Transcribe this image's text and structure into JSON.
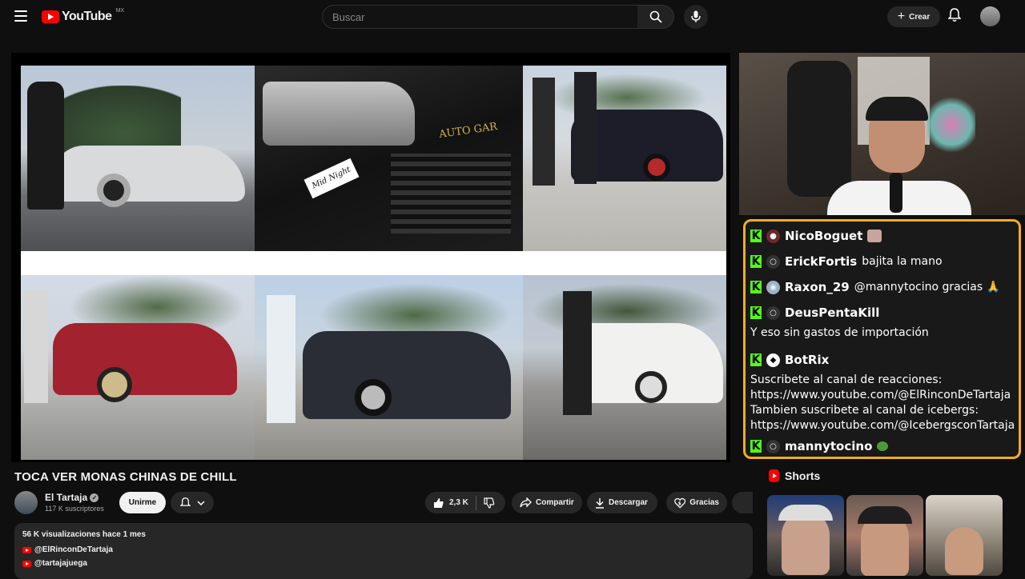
{
  "header": {
    "logo_text": "YouTube",
    "country_code": "MX",
    "search_placeholder": "Buscar",
    "create_label": "Crear"
  },
  "chat": {
    "messages": [
      {
        "user": "NicoBoguet",
        "text": "",
        "emote": "emote-face"
      },
      {
        "user": "ErickFortis",
        "text": "bajita la mano"
      },
      {
        "user": "Raxon_29",
        "text": "@mannytocino gracias 🙏"
      },
      {
        "user": "DeusPentaKill",
        "text": "Y eso sin gastos de importación"
      },
      {
        "user": "BotRix",
        "text": "Suscribete al canal de reacciones: https://www.youtube.com/@ElRinconDeTartaja Tambien suscribete al canal de icebergs: https://www.youtube.com/@IcebergsconTartaja"
      },
      {
        "user": "mannytocino",
        "text": "",
        "emote": "emote-frog"
      }
    ],
    "botrix_lines": [
      "Suscribete al canal de reacciones:",
      "https://www.youtube.com/@ElRinconDeTartaja",
      "Tambien suscribete al canal de icebergs:",
      "https://www.youtube.com/@IcebergsconTartaja"
    ],
    "badge_letter": "K",
    "accent_color": "#f2ad1f",
    "badge_color": "#53fc18"
  },
  "video": {
    "title": "TOCA VER MONAS CHINAS DE CHILL",
    "photo_text_1": "AUTO GAR",
    "photo_text_2": "Mid Night"
  },
  "channel": {
    "name": "El Tartaja",
    "subscribers": "117 K suscriptores",
    "join_label": "Unirme"
  },
  "actions": {
    "likes": "2,3 K",
    "share": "Compartir",
    "download": "Descargar",
    "thanks": "Gracias"
  },
  "description": {
    "meta": "56 K visualizaciones  hace 1 mes",
    "links": [
      "@ElRinconDeTartaja",
      "@tartajajuega"
    ]
  },
  "shorts": {
    "heading": "Shorts"
  }
}
